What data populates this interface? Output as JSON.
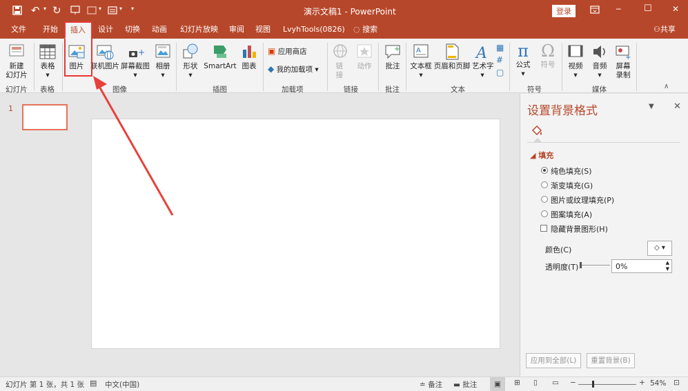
{
  "titlebar": {
    "title": "演示文稿1 - PowerPoint",
    "login": "登录",
    "minimize": "─",
    "maximize": "☐",
    "close": "✕"
  },
  "tabs": [
    "文件",
    "开始",
    "插入",
    "设计",
    "切换",
    "动画",
    "幻灯片放映",
    "审阅",
    "视图",
    "LvyhTools(0826)",
    "搜索"
  ],
  "share": "共享",
  "ribbon": {
    "new_slide": [
      "新建",
      "幻灯片"
    ],
    "table": "表格",
    "picture": "图片",
    "online_picture": "联机图片",
    "screenshot": "屏幕截图",
    "album": "相册",
    "shapes": "形状",
    "smartart": "SmartArt",
    "chart": "图表",
    "store": "应用商店",
    "my_addins": "我的加载项",
    "link": [
      "链",
      "接"
    ],
    "action": "动作",
    "comment": "批注",
    "textbox": "文本框",
    "header_footer": "页眉和页脚",
    "wordart": "艺术字",
    "equation": "公式",
    "symbol": "符号",
    "video": "视频",
    "audio": "音频",
    "screen_record": [
      "屏幕",
      "录制"
    ],
    "groups": [
      "幻灯片",
      "表格",
      "图像",
      "插图",
      "加载项",
      "链接",
      "批注",
      "文本",
      "符号",
      "媒体"
    ]
  },
  "thumb": {
    "number": "1"
  },
  "panel": {
    "title": "设置背景格式",
    "section": "填充",
    "options": [
      "纯色填充(S)",
      "渐变填充(G)",
      "图片或纹理填充(P)",
      "图案填充(A)"
    ],
    "hide_bg": "隐藏背景图形(H)",
    "color_label": "颜色(C)",
    "transparency_label": "透明度(T)",
    "transparency_value": "0%",
    "apply_all": "应用到全部(L)",
    "reset": "重置背景(B)"
  },
  "status": {
    "slide_info": "幻灯片 第 1 张，共 1 张",
    "language": "中文(中国)",
    "notes": "备注",
    "comments": "批注",
    "zoom": "54%"
  },
  "colors": {
    "accent": "#b7472a",
    "highlight": "#e53935",
    "arrow": "#e8413b"
  }
}
